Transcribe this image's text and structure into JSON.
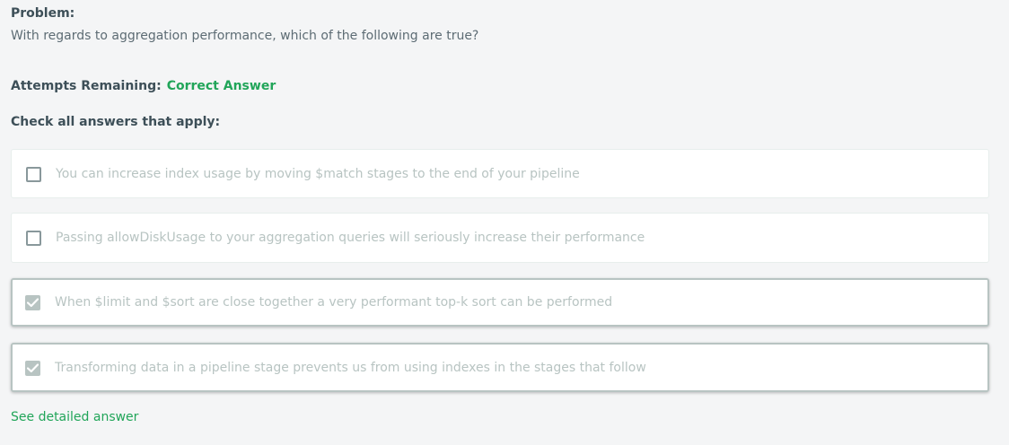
{
  "problem": {
    "title": "Problem:",
    "question": "With regards to aggregation performance, which of the following are true?"
  },
  "attempts": {
    "label": "Attempts Remaining:",
    "status": "Correct Answer",
    "status_color": "#21a559"
  },
  "instructions": "Check all answers that apply:",
  "options": [
    {
      "label": "You can increase index usage by moving $match stages to the end of your pipeline",
      "checked": false
    },
    {
      "label": "Passing allowDiskUsage to your aggregation queries will seriously increase their performance",
      "checked": false
    },
    {
      "label": "When $limit and $sort are close together a very performant top-k sort can be performed",
      "checked": true
    },
    {
      "label": "Transforming data in a pipeline stage prevents us from using indexes in the stages that follow",
      "checked": true
    }
  ],
  "see_answer_link": "See detailed answer",
  "icons": {
    "checkbox": "checkbox-icon",
    "checkmark": "checkmark-icon"
  }
}
